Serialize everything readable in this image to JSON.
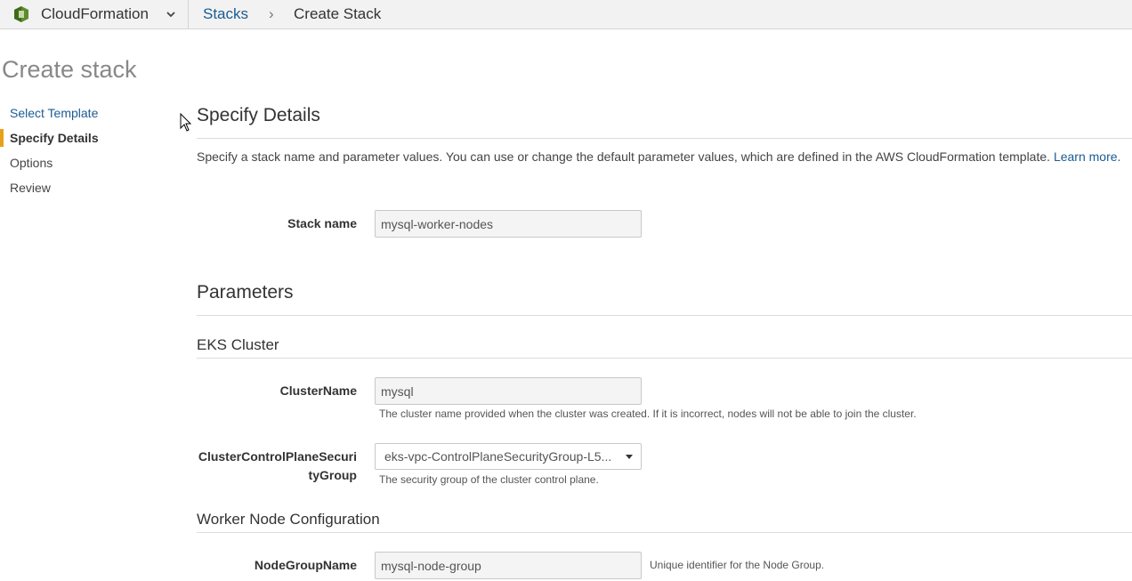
{
  "topbar": {
    "service_name": "CloudFormation",
    "breadcrumb": {
      "stacks": "Stacks",
      "separator": "›",
      "current": "Create Stack"
    }
  },
  "page_title": "Create stack",
  "wizard_steps": [
    {
      "label": "Select Template",
      "state": "link"
    },
    {
      "label": "Specify Details",
      "state": "active"
    },
    {
      "label": "Options",
      "state": "plain"
    },
    {
      "label": "Review",
      "state": "plain"
    }
  ],
  "specify_details": {
    "heading": "Specify Details",
    "description": "Specify a stack name and parameter values. You can use or change the default parameter values, which are defined in the AWS CloudFormation template.",
    "learn_more": "Learn more.",
    "stack_name_label": "Stack name",
    "stack_name_value": "mysql-worker-nodes"
  },
  "parameters": {
    "heading": "Parameters",
    "eks_cluster": {
      "heading": "EKS Cluster",
      "cluster_name_label": "ClusterName",
      "cluster_name_value": "mysql",
      "cluster_name_help": "The cluster name provided when the cluster was created. If it is incorrect, nodes will not be able to join the cluster.",
      "sg_label_line1": "ClusterControlPlaneSecuri",
      "sg_label_line2": "tyGroup",
      "sg_value": "eks-vpc-ControlPlaneSecurityGroup-L5...",
      "sg_help": "The security group of the cluster control plane."
    },
    "worker_node": {
      "heading": "Worker Node Configuration",
      "node_group_label": "NodeGroupName",
      "node_group_value": "mysql-node-group",
      "node_group_help": "Unique identifier for the Node Group."
    }
  },
  "colors": {
    "link": "#1b5c93",
    "active_marker": "#e7a21a",
    "logo": "#5f8a2e"
  },
  "icons": {
    "logo": "cloudformation-logo-icon",
    "chevron": "chevron-down-icon",
    "caret": "caret-down-icon",
    "cursor": "mouse-pointer-icon"
  }
}
